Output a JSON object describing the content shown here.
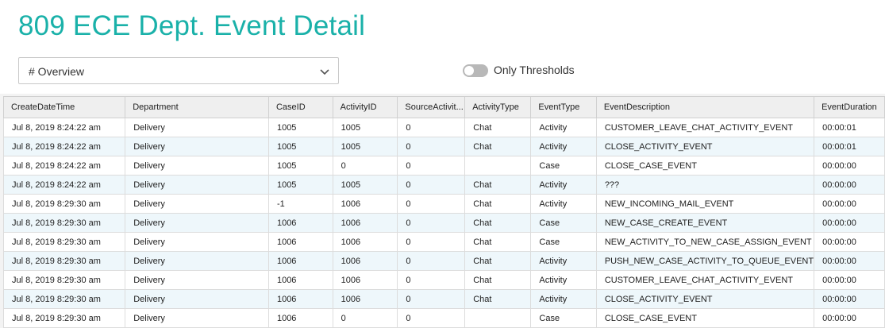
{
  "header": {
    "title": "809 ECE Dept. Event Detail"
  },
  "view_select": {
    "value": "# Overview",
    "icon": "chevron-down-icon"
  },
  "thresholds_toggle": {
    "label": "Only Thresholds",
    "enabled": false
  },
  "table": {
    "columns": [
      "CreateDateTime",
      "Department",
      "CaseID",
      "ActivityID",
      "SourceActivit...",
      "ActivityType",
      "EventType",
      "EventDescription",
      "EventDuration"
    ],
    "rows": [
      [
        "Jul 8, 2019 8:24:22 am",
        "Delivery",
        "1005",
        "1005",
        "0",
        "Chat",
        "Activity",
        "CUSTOMER_LEAVE_CHAT_ACTIVITY_EVENT",
        "00:00:01"
      ],
      [
        "Jul 8, 2019 8:24:22 am",
        "Delivery",
        "1005",
        "1005",
        "0",
        "Chat",
        "Activity",
        "CLOSE_ACTIVITY_EVENT",
        "00:00:01"
      ],
      [
        "Jul 8, 2019 8:24:22 am",
        "Delivery",
        "1005",
        "0",
        "0",
        "",
        "Case",
        "CLOSE_CASE_EVENT",
        "00:00:00"
      ],
      [
        "Jul 8, 2019 8:24:22 am",
        "Delivery",
        "1005",
        "1005",
        "0",
        "Chat",
        "Activity",
        "???",
        "00:00:00"
      ],
      [
        "Jul 8, 2019 8:29:30 am",
        "Delivery",
        "-1",
        "1006",
        "0",
        "Chat",
        "Activity",
        "NEW_INCOMING_MAIL_EVENT",
        "00:00:00"
      ],
      [
        "Jul 8, 2019 8:29:30 am",
        "Delivery",
        "1006",
        "1006",
        "0",
        "Chat",
        "Case",
        "NEW_CASE_CREATE_EVENT",
        "00:00:00"
      ],
      [
        "Jul 8, 2019 8:29:30 am",
        "Delivery",
        "1006",
        "1006",
        "0",
        "Chat",
        "Case",
        "NEW_ACTIVITY_TO_NEW_CASE_ASSIGN_EVENT",
        "00:00:00"
      ],
      [
        "Jul 8, 2019 8:29:30 am",
        "Delivery",
        "1006",
        "1006",
        "0",
        "Chat",
        "Activity",
        "PUSH_NEW_CASE_ACTIVITY_TO_QUEUE_EVENT",
        "00:00:00"
      ],
      [
        "Jul 8, 2019 8:29:30 am",
        "Delivery",
        "1006",
        "1006",
        "0",
        "Chat",
        "Activity",
        "CUSTOMER_LEAVE_CHAT_ACTIVITY_EVENT",
        "00:00:00"
      ],
      [
        "Jul 8, 2019 8:29:30 am",
        "Delivery",
        "1006",
        "1006",
        "0",
        "Chat",
        "Activity",
        "CLOSE_ACTIVITY_EVENT",
        "00:00:00"
      ],
      [
        "Jul 8, 2019 8:29:30 am",
        "Delivery",
        "1006",
        "0",
        "0",
        "",
        "Case",
        "CLOSE_CASE_EVENT",
        "00:00:00"
      ]
    ]
  },
  "colors": {
    "title": "#1ab1a9",
    "row_alt": "#eef7fb",
    "header_bg": "#efefef"
  }
}
